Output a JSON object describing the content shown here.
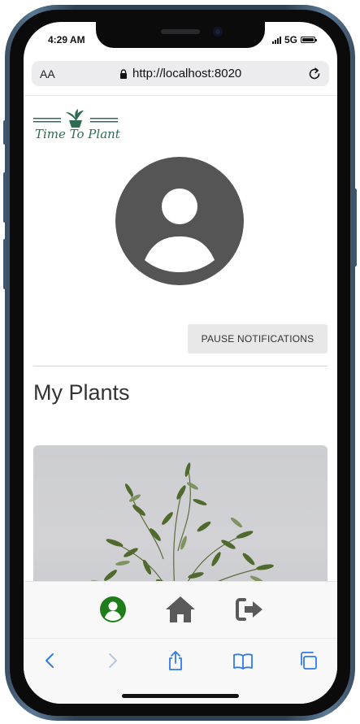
{
  "status_bar": {
    "time": "4:29 AM",
    "network": "5G"
  },
  "browser": {
    "text_size_label": "AA",
    "url": "http://localhost:8020"
  },
  "app": {
    "logo_text": "Time To Plant",
    "pause_button_label": "PAUSE NOTIFICATIONS",
    "section_title": "My Plants"
  },
  "tab_bar": {
    "icons": [
      "user-circle-icon",
      "home-icon",
      "sign-out-icon"
    ],
    "active_color": "#1e7d1a",
    "icon_color": "#5a5a5a"
  },
  "safari_toolbar": {
    "icons": [
      "back-icon",
      "forward-icon",
      "share-icon",
      "bookmarks-icon",
      "tabs-icon"
    ],
    "accent": "#2f7bea"
  }
}
